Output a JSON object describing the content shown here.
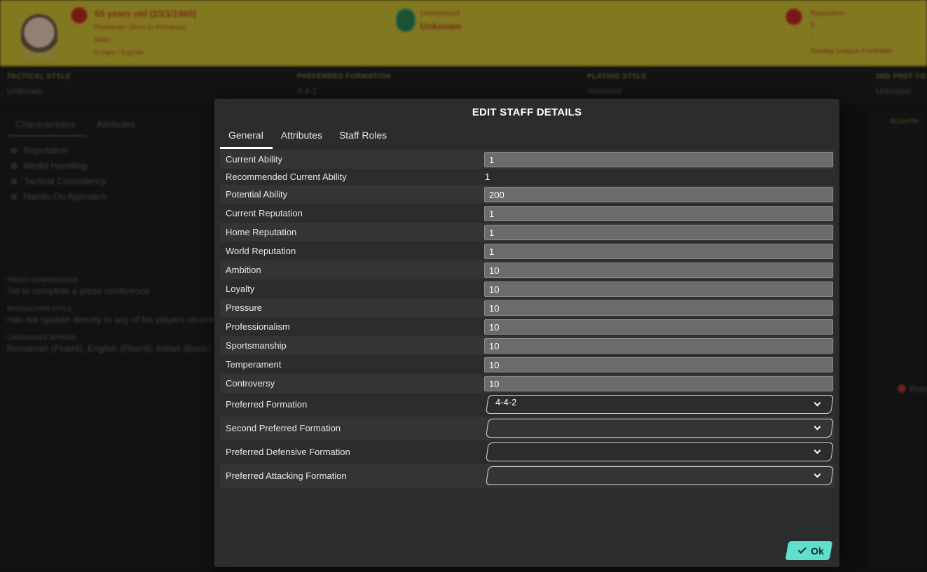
{
  "background": {
    "age_line": "55 years old (23/1/1965)",
    "birth_line": "Romanian (Born in Romania)",
    "status_line": "Male",
    "caps_line": "0 caps / 0 goals",
    "unemployed_label": "Unemployed",
    "unknown_label": "Unknown",
    "reputation_label": "Reputation",
    "reputation_value": "0",
    "reputation_dash": "-",
    "reputation_desc": "Sunday League Footballer",
    "meta": [
      {
        "label": "TACTICAL STYLE",
        "value": "Unknown"
      },
      {
        "label": "PREFERRED FORMATION",
        "value": "4-4-2"
      },
      {
        "label": "PLAYING STYLE",
        "value": "Standard"
      },
      {
        "label": "2ND PREF FO",
        "value": "Unknown"
      }
    ],
    "side_tabs": [
      "Characteristics",
      "Attributes"
    ],
    "characteristics": [
      "Reputation",
      "Media Handling",
      "Tactical Consistency",
      "Hands-On Approach"
    ],
    "press_conf_label": "PRESS CONFERENCES",
    "press_conf_value": "Yet to complete a press conference",
    "interaction_label": "INTERACTION STYLE",
    "interaction_value": "Has not spoken directly to any of his players recently",
    "languages_label": "LANGUAGES SPOKEN",
    "languages_value": "Romanian (Fluent), English (Fluent), Italian (Basic)",
    "right_panel_label": "SCOUTIN",
    "right_flag_text": "Rom"
  },
  "dialog": {
    "title": "EDIT STAFF DETAILS",
    "tabs": [
      {
        "label": "General",
        "active": true
      },
      {
        "label": "Attributes",
        "active": false
      },
      {
        "label": "Staff Roles",
        "active": false
      }
    ],
    "fields": [
      {
        "label": "Current Ability",
        "value": "1"
      },
      {
        "label": "Recommended Current Ability",
        "value": "1"
      },
      {
        "label": "Potential Ability",
        "value": "200"
      },
      {
        "label": "Current Reputation",
        "value": "1"
      },
      {
        "label": "Home Reputation",
        "value": "1"
      },
      {
        "label": "World Reputation",
        "value": "1"
      },
      {
        "label": "Ambition",
        "value": "10"
      },
      {
        "label": "Loyalty",
        "value": "10"
      },
      {
        "label": "Pressure",
        "value": "10"
      },
      {
        "label": "Professionalism",
        "value": "10"
      },
      {
        "label": "Sportsmanship",
        "value": "10"
      },
      {
        "label": "Temperament",
        "value": "10"
      },
      {
        "label": "Controversy",
        "value": "10"
      }
    ],
    "formations": [
      {
        "label": "Preferred Formation",
        "value": "4-4-2"
      },
      {
        "label": "Second Preferred Formation",
        "value": ""
      },
      {
        "label": "Preferred Defensive Formation",
        "value": ""
      },
      {
        "label": "Preferred Attacking Formation",
        "value": ""
      }
    ],
    "ok_label": "Ok"
  },
  "colors": {
    "header_yellow": "#c7b832",
    "dialog_bg": "#2b2c2d",
    "ok_button": "#5fe0cc"
  }
}
